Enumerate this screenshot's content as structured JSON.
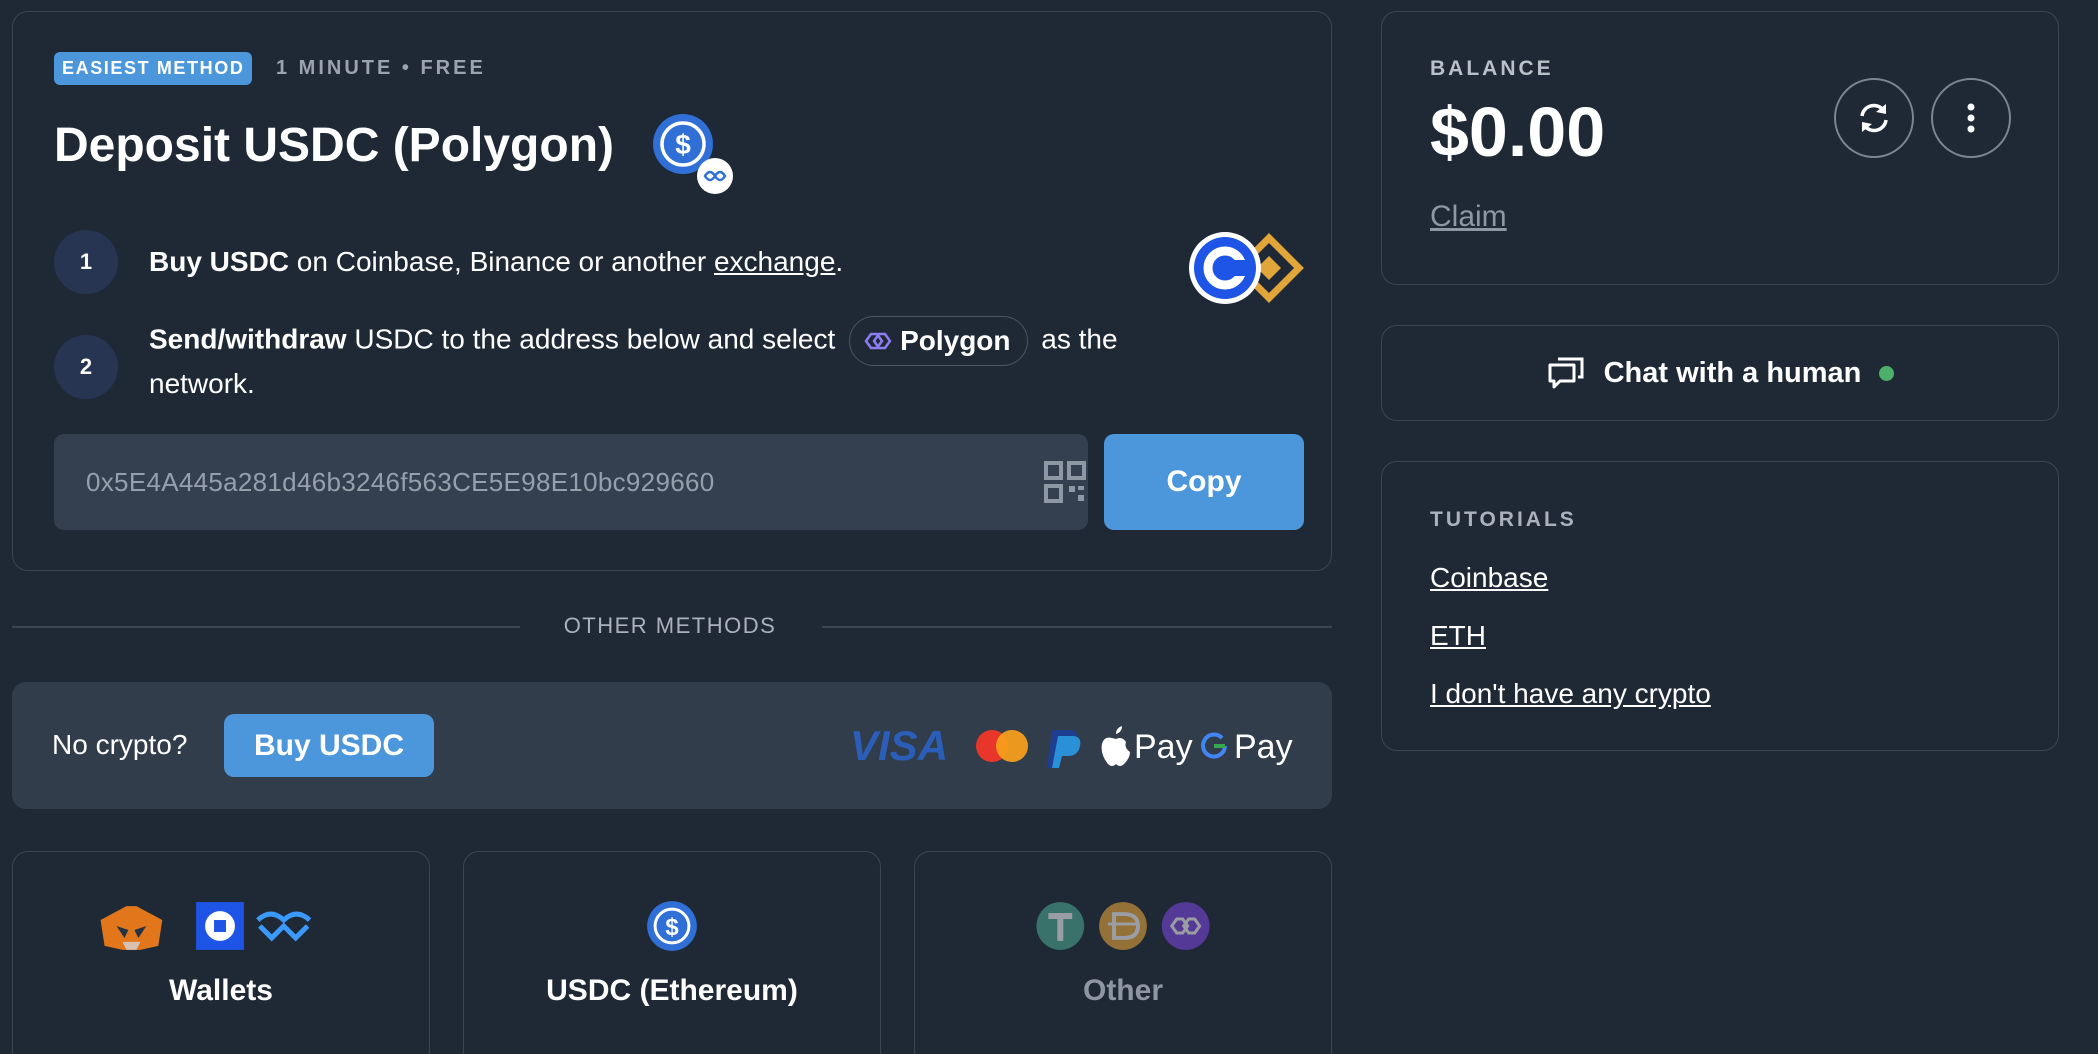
{
  "deposit": {
    "badge": "EASIEST METHOD",
    "meta": "1 MINUTE • FREE",
    "title": "Deposit USDC (Polygon)",
    "step1": {
      "number": "1",
      "bold": "Buy USDC",
      "text": " on Coinbase, Binance or another ",
      "link": "exchange",
      "end": "."
    },
    "step2": {
      "number": "2",
      "bold": "Send/withdraw",
      "text": " USDC to the address below and select",
      "network": "Polygon",
      "end": "as the network."
    },
    "address": "0x5E4A445a281d46b3246f563CE5E98E10bc929660",
    "copy_label": "Copy"
  },
  "other_methods": {
    "label": "OTHER METHODS",
    "no_crypto": "No crypto?",
    "buy_label": "Buy USDC",
    "payment_logos": [
      "VISA",
      "mastercard",
      "paypal",
      "Pay",
      "Pay"
    ]
  },
  "tiles": [
    {
      "label": "Wallets",
      "icons": [
        "metamask-icon",
        "coinbase-wallet-icon",
        "walletconnect-icon"
      ]
    },
    {
      "label": "USDC (Ethereum)",
      "icons": [
        "usdc-icon"
      ]
    },
    {
      "label": "Other",
      "icons": [
        "tether-icon",
        "dai-icon",
        "polygon-icon"
      ]
    }
  ],
  "balance": {
    "label": "BALANCE",
    "value": "$0.00",
    "claim": "Claim"
  },
  "chat": {
    "label": "Chat with a human"
  },
  "tutorials": {
    "label": "TUTORIALS",
    "links": [
      "Coinbase",
      "ETH",
      "I don't have any crypto"
    ]
  },
  "colors": {
    "background": "#1f2936",
    "accent": "#4c97dc",
    "online": "#4caf6a"
  }
}
